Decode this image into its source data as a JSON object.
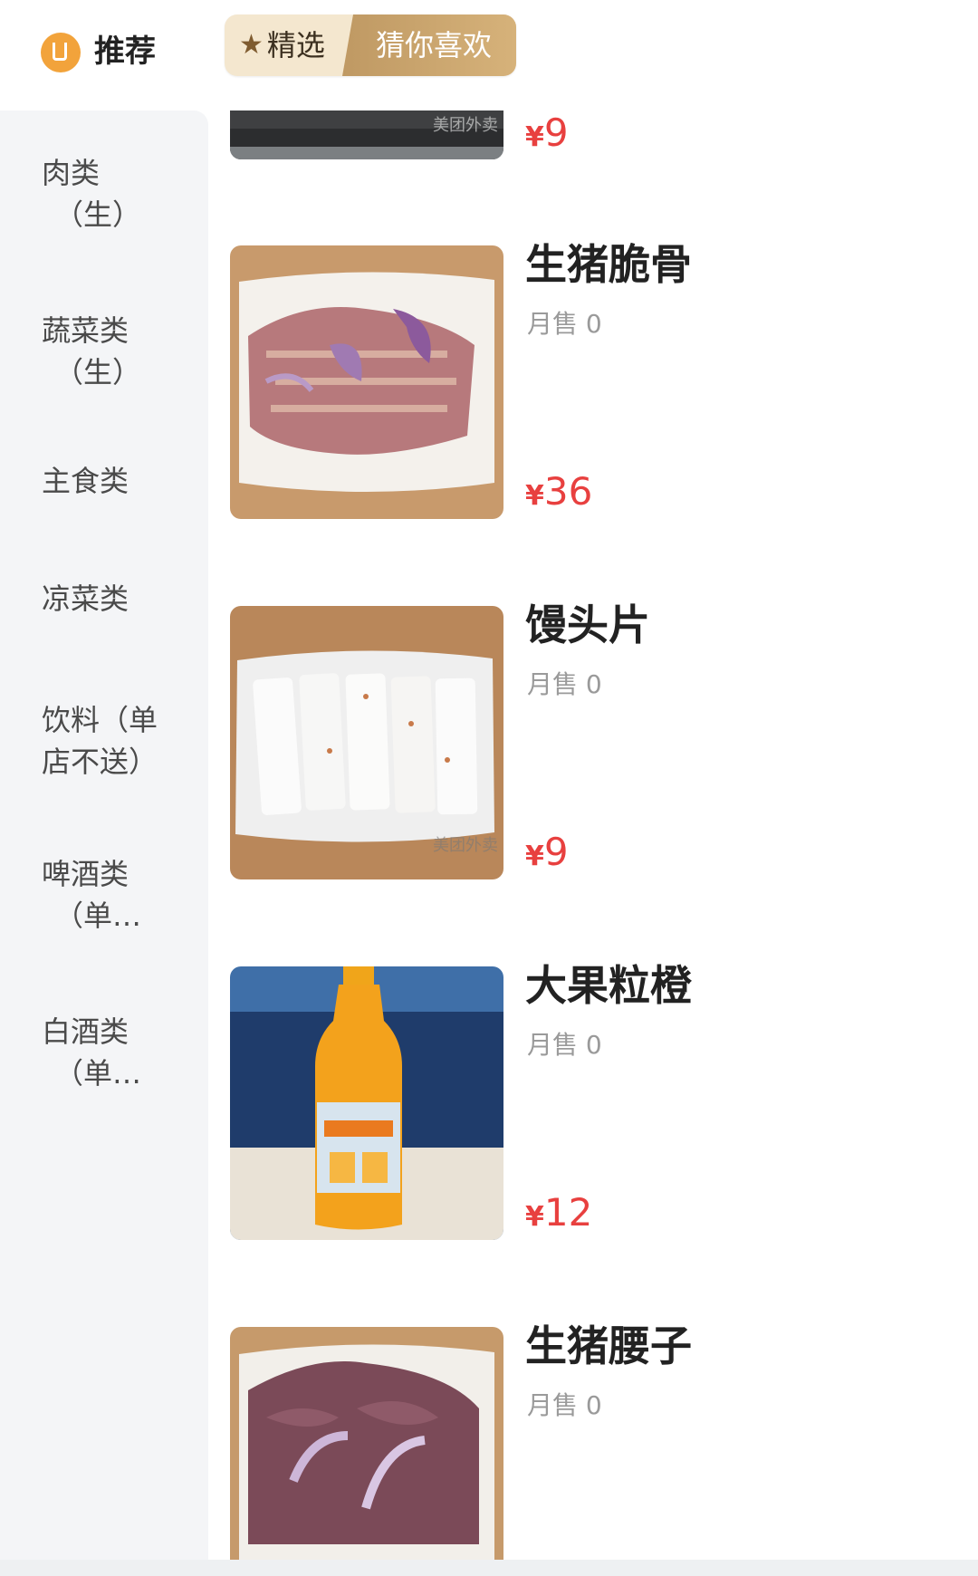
{
  "header": {
    "recommend_label": "推荐",
    "segment": {
      "option1": "精选",
      "option2": "猜你喜欢"
    }
  },
  "sidebar": {
    "categories": [
      {
        "line1": "肉类",
        "line2": "（生）"
      },
      {
        "line1": "蔬菜类",
        "line2": "（生）"
      },
      {
        "line1": "主食类",
        "line2": ""
      },
      {
        "line1": "凉菜类",
        "line2": ""
      },
      {
        "line1": "饮料（单",
        "line2": "店不送）"
      },
      {
        "line1": "啤酒类",
        "line2": "（单…"
      },
      {
        "line1": "白酒类",
        "line2": "（单…"
      }
    ]
  },
  "products": [
    {
      "name": "",
      "sales": "",
      "price_symbol": "¥",
      "price": "9",
      "image": "grill-plate-photo",
      "watermark": "美团外卖"
    },
    {
      "name": "生猪脆骨",
      "sales": "月售 0",
      "price_symbol": "¥",
      "price": "36",
      "image": "raw-pork-cartilage-photo"
    },
    {
      "name": "馒头片",
      "sales": "月售 0",
      "price_symbol": "¥",
      "price": "9",
      "image": "steamed-bread-slices-photo",
      "watermark": "美团外卖"
    },
    {
      "name": "大果粒橙",
      "sales": "月售 0",
      "price_symbol": "¥",
      "price": "12",
      "image": "orange-juice-bottle-photo"
    },
    {
      "name": "生猪腰子",
      "sales": "月售 0",
      "price_symbol": "",
      "price": "",
      "image": "raw-pork-kidney-photo"
    }
  ],
  "colors": {
    "price": "#e8403f",
    "accent_gold": "#c9a36a",
    "sidebar_bg": "#f4f5f7",
    "icon_orange": "#f2a33b"
  }
}
